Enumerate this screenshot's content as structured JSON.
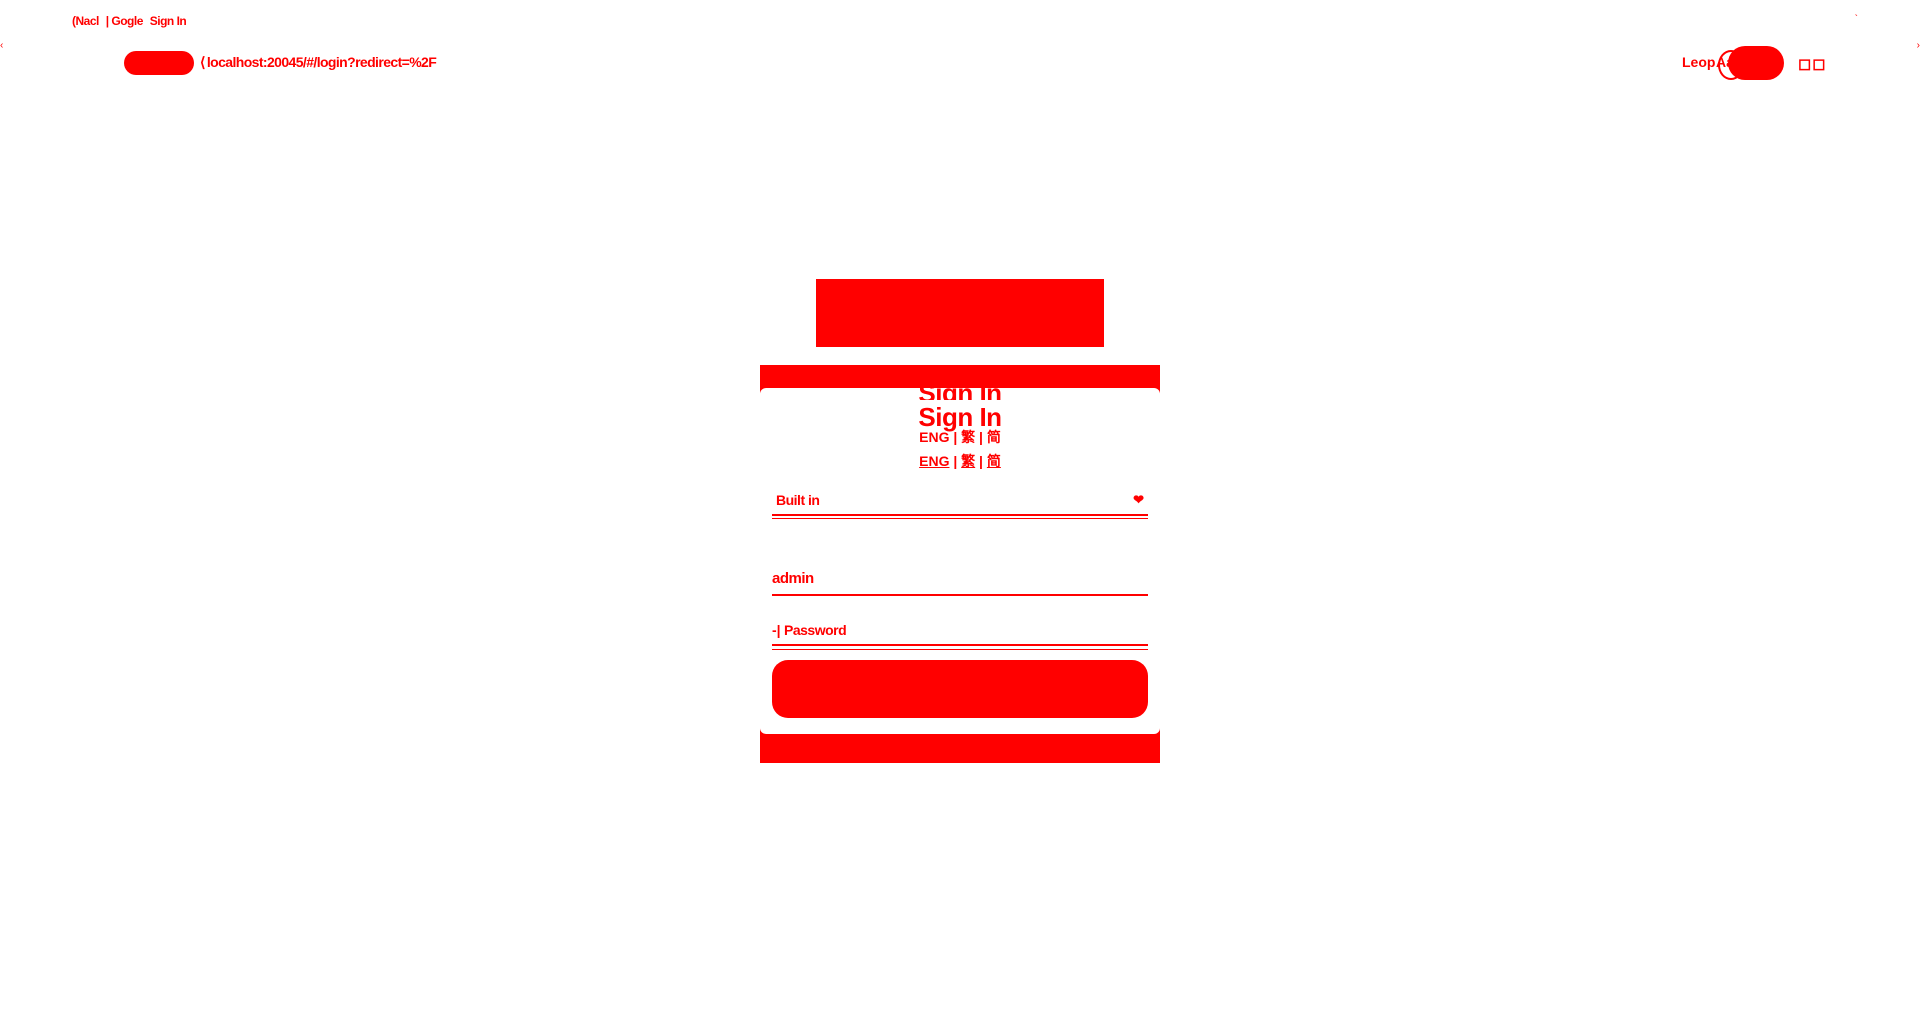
{
  "browser": {
    "tab_fragments": [
      "(Nacl",
      "| Gogle",
      "Sign In"
    ],
    "url": "localhost:20045/#/login?redirect=%2F",
    "right_controls": [
      "Leop",
      "Aa"
    ],
    "window_buttons": "◻◻"
  },
  "login": {
    "title": "Sign In",
    "languages": [
      "ENG",
      "繁",
      "简"
    ],
    "domain_value": "Built in",
    "username_value": "admin",
    "password_placeholder": "Password",
    "signin_label": ""
  },
  "colors": {
    "accent": "#ff0000",
    "background": "#ffffff"
  }
}
